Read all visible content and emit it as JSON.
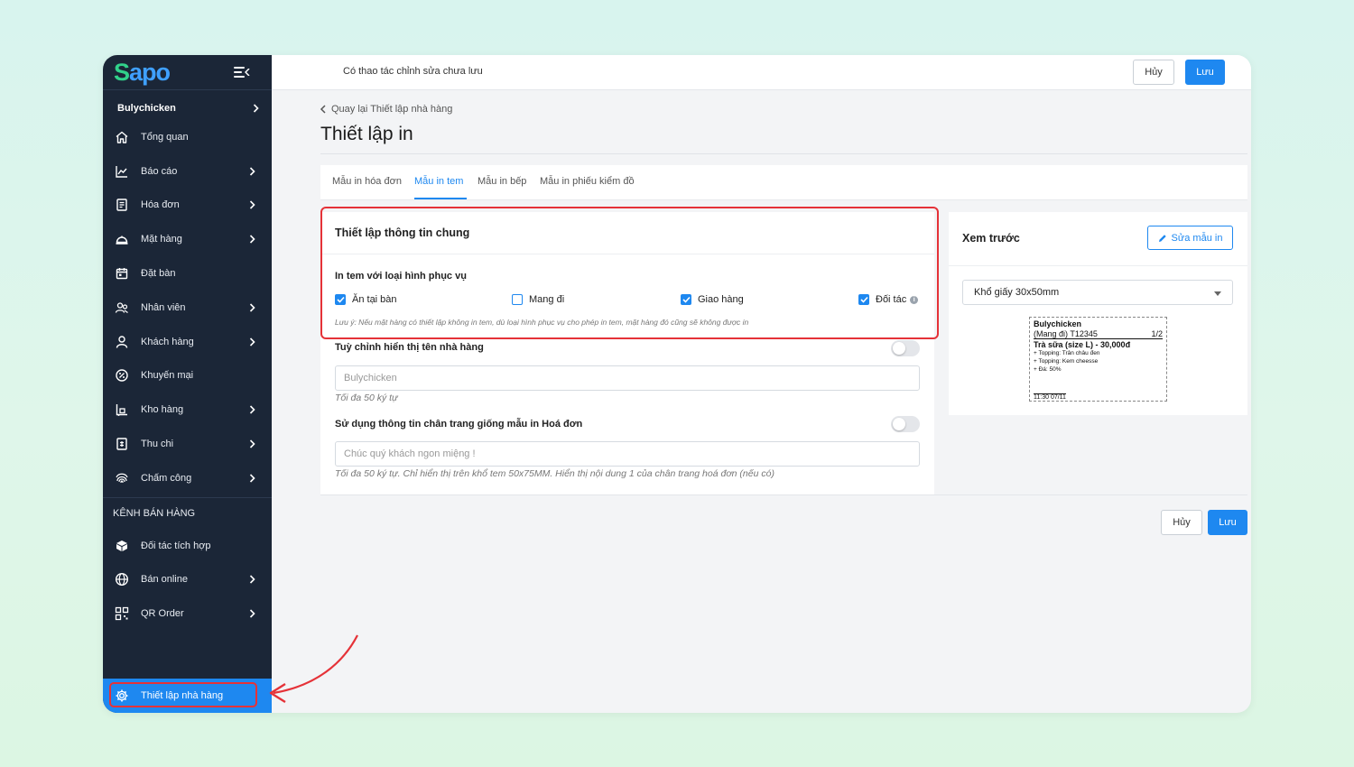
{
  "sidebar": {
    "logo": {
      "first": "S",
      "rest": "apo"
    },
    "store_name": "Bulychicken",
    "items": [
      {
        "label": "Tổng quan",
        "icon": "home-icon",
        "chevron": false
      },
      {
        "label": "Báo cáo",
        "icon": "chart-icon",
        "chevron": true
      },
      {
        "label": "Hóa đơn",
        "icon": "receipt-icon",
        "chevron": true
      },
      {
        "label": "Mặt hàng",
        "icon": "cloche-icon",
        "chevron": true
      },
      {
        "label": "Đặt bàn",
        "icon": "calendar-icon",
        "chevron": false
      },
      {
        "label": "Nhân viên",
        "icon": "staff-icon",
        "chevron": true
      },
      {
        "label": "Khách hàng",
        "icon": "user-icon",
        "chevron": true
      },
      {
        "label": "Khuyến mại",
        "icon": "discount-icon",
        "chevron": false
      },
      {
        "label": "Kho hàng",
        "icon": "warehouse-icon",
        "chevron": true
      },
      {
        "label": "Thu chi",
        "icon": "cashbook-icon",
        "chevron": true
      },
      {
        "label": "Chấm công",
        "icon": "fingerprint-icon",
        "chevron": true
      }
    ],
    "channels_title": "KÊNH BÁN HÀNG",
    "channel_items": [
      {
        "label": "Đối tác tích hợp",
        "icon": "partner-icon",
        "chevron": false
      },
      {
        "label": "Bán online",
        "icon": "globe-icon",
        "chevron": true
      },
      {
        "label": "QR Order",
        "icon": "qr-icon",
        "chevron": true
      }
    ],
    "settings_label": "Thiết lập nhà hàng"
  },
  "topbar": {
    "unsaved_text": "Có thao tác chỉnh sửa chưa lưu",
    "cancel_label": "Hủy",
    "save_label": "Lưu"
  },
  "breadcrumb": {
    "back_label": "Quay lại Thiết lập nhà hàng"
  },
  "page_title": "Thiết lập in",
  "tabs": [
    {
      "label": "Mẫu in hóa đơn",
      "active": false
    },
    {
      "label": "Mẫu in tem",
      "active": true
    },
    {
      "label": "Mẫu in bếp",
      "active": false
    },
    {
      "label": "Mẫu in phiếu kiểm đồ",
      "active": false
    }
  ],
  "general": {
    "title": "Thiết lập thông tin chung",
    "service_label": "In tem với loại hình phục vụ",
    "options": [
      {
        "label": "Ăn tại bàn",
        "checked": true
      },
      {
        "label": "Mang đi",
        "checked": false
      },
      {
        "label": "Giao hàng",
        "checked": true
      },
      {
        "label": "Đối tác",
        "checked": true
      }
    ],
    "note": "Lưu ý: Nếu mặt hàng có thiết lập không in tem, dù loại hình phục vụ cho phép in tem, mặt hàng đó cũng sẽ không được in",
    "custom_name_label": "Tuỳ chỉnh hiển thị tên nhà hàng",
    "custom_name_placeholder": "Bulychicken",
    "custom_name_hint": "Tối đa 50 ký tự",
    "footer_label": "Sử dụng thông tin chân trang giống mẫu in Hoá đơn",
    "footer_placeholder": "Chúc quý khách ngon miệng !",
    "footer_hint": "Tối đa 50 ký tự. Chỉ hiển thị trên khổ tem 50x75MM. Hiển thị nội dung 1 của chân trang hoá đơn (nếu có)"
  },
  "preview": {
    "title": "Xem trước",
    "edit_label": "Sửa mẫu in",
    "paper_size": "Khổ giấy 30x50mm",
    "label": {
      "store": "Bulychicken",
      "order": "(Mang đi) T12345",
      "page": "1/2",
      "item": "Trà sữa (size L) - 30,000đ",
      "topping1": "+ Topping: Trân châu đen",
      "topping2": "+ Topping: Kem cheesse",
      "ice": "+ Đá: 50%",
      "time": "11:30 07/11"
    }
  },
  "footer_actions": {
    "cancel_label": "Hủy",
    "save_label": "Lưu"
  },
  "colors": {
    "primary": "#1e88f0",
    "sidebar": "#1b2637",
    "highlight": "#e53238",
    "logo_green": "#31d18a"
  }
}
